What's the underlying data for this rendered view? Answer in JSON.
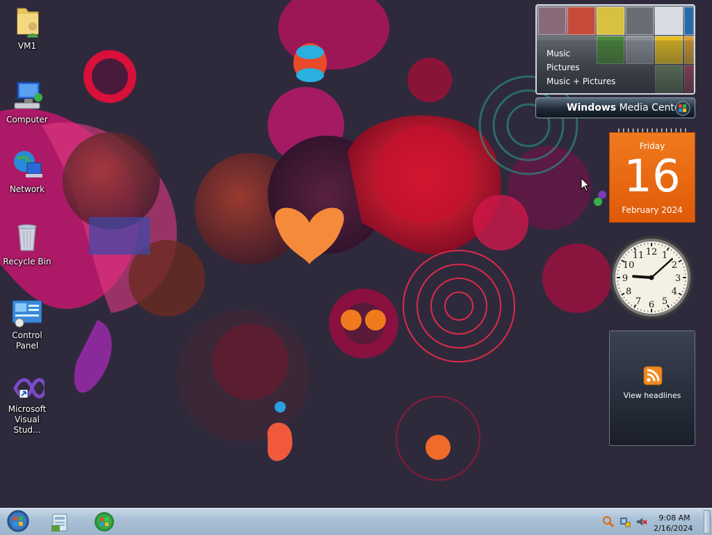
{
  "desktop": {
    "icons": [
      {
        "label": "VM1",
        "icon": "user-folder-icon"
      },
      {
        "label": "Computer",
        "icon": "computer-icon"
      },
      {
        "label": "Network",
        "icon": "network-icon"
      },
      {
        "label": "Recycle Bin",
        "icon": "recycle-bin-icon"
      },
      {
        "label": "Control Panel",
        "icon": "control-panel-icon"
      },
      {
        "label": "Microsoft Visual Stud...",
        "icon": "visual-studio-icon"
      }
    ]
  },
  "gadgets": {
    "media_center": {
      "menu": [
        "Music",
        "Pictures",
        "Music + Pictures"
      ],
      "title_bold": "Windows",
      "title_rest": " Media Center"
    },
    "calendar": {
      "weekday": "Friday",
      "day": "16",
      "month_year": "February 2024",
      "color": "#e8650f"
    },
    "clock": {
      "hour": 9,
      "minute": 8
    },
    "feed": {
      "link": "View headlines",
      "icon": "rss-icon"
    }
  },
  "taskbar": {
    "start_icon": "windows-start-orb",
    "pinned": [
      "explorer-icon",
      "media-player-icon"
    ],
    "tray": {
      "icons": [
        "search-icon",
        "network-tray-icon",
        "volume-muted-icon"
      ],
      "time": "9:08 AM",
      "date": "2/16/2024"
    }
  },
  "colors": {
    "wallpaper_base": "#2b2440",
    "accent_magenta": "#c0156a",
    "accent_orange": "#f07a1e",
    "taskbar": "#a9c0d6"
  }
}
